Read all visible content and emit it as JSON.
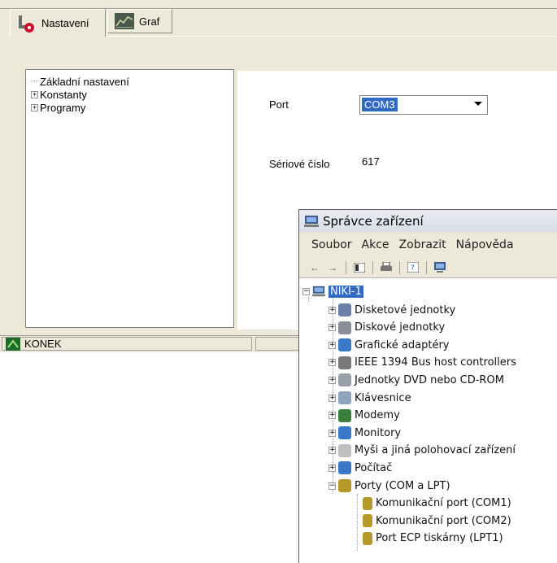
{
  "tabs": [
    {
      "label": "Nastavení",
      "icon": "settings-tab-icon"
    },
    {
      "label": "Graf",
      "icon": "chart-tab-icon"
    }
  ],
  "tree": {
    "items": [
      {
        "label": "Základní nastavení",
        "expander": "none"
      },
      {
        "label": "Konstanty",
        "expander": "+"
      },
      {
        "label": "Programy",
        "expander": "+"
      }
    ]
  },
  "settings": {
    "port_label": "Port",
    "port_value": "COM3",
    "serial_label": "Sériové číslo",
    "serial_value": "617"
  },
  "status": {
    "text": "KONEK",
    "icon": "connect-icon"
  },
  "device_manager": {
    "title": "Správce zařízení",
    "menu": [
      "Soubor",
      "Akce",
      "Zobrazit",
      "Nápověda"
    ],
    "root": "NIKI-1",
    "categories": [
      {
        "label": "Disketové jednotky",
        "icon": "floppy-icon",
        "color": "#6b7fa8"
      },
      {
        "label": "Diskové jednotky",
        "icon": "disk-icon",
        "color": "#8a8f9a"
      },
      {
        "label": "Grafické adaptéry",
        "icon": "display-adapter-icon",
        "color": "#3a78c8"
      },
      {
        "label": "IEEE 1394 Bus host controllers",
        "icon": "ieee1394-icon",
        "color": "#7a7a7a"
      },
      {
        "label": "Jednotky DVD nebo CD-ROM",
        "icon": "dvd-icon",
        "color": "#9aa0aa"
      },
      {
        "label": "Klávesnice",
        "icon": "keyboard-icon",
        "color": "#8fa3bf"
      },
      {
        "label": "Modemy",
        "icon": "modem-icon",
        "color": "#3b7d3b"
      },
      {
        "label": "Monitory",
        "icon": "monitor-icon",
        "color": "#3a78c8"
      },
      {
        "label": "Myši a jiná polohovací zařízení",
        "icon": "mouse-icon",
        "color": "#c0c0c0"
      },
      {
        "label": "Počítač",
        "icon": "computer-icon",
        "color": "#3a78c8"
      },
      {
        "label": "Porty (COM a LPT)",
        "icon": "port-icon",
        "color": "#b59a2a"
      }
    ],
    "ports": [
      {
        "label": "Komunikační port (COM1)",
        "icon": "com-port-icon"
      },
      {
        "label": "Komunikační port (COM2)",
        "icon": "com-port-icon"
      },
      {
        "label": "Port ECP tiskárny (LPT1)",
        "icon": "lpt-port-icon"
      }
    ]
  }
}
